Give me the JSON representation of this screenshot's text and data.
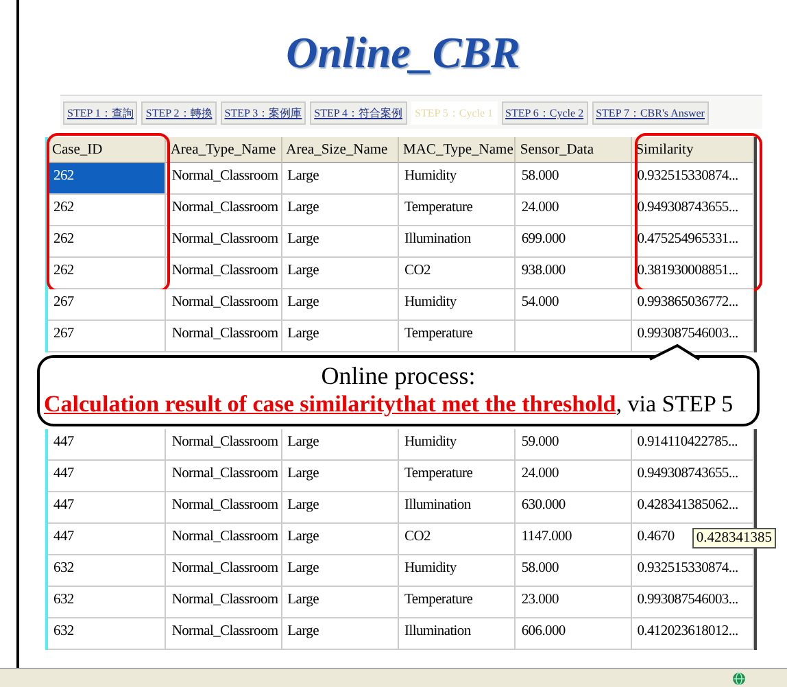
{
  "title": "Online_CBR",
  "tabs": [
    {
      "label": "STEP 1：查詢",
      "selected": false
    },
    {
      "label": "STEP 2：轉換",
      "selected": false
    },
    {
      "label": "STEP 3：案例庫",
      "selected": false
    },
    {
      "label": "STEP 4：符合案例",
      "selected": false
    },
    {
      "label": "STEP 5：Cycle 1",
      "selected": true
    },
    {
      "label": "STEP 6：Cycle 2",
      "selected": false
    },
    {
      "label": "STEP 7：CBR's Answer",
      "selected": false
    }
  ],
  "table": {
    "columns": [
      {
        "label": "Case_ID",
        "highlighted": true
      },
      {
        "label": "Area_Type_Name",
        "highlighted": false
      },
      {
        "label": "Area_Size_Name",
        "highlighted": false
      },
      {
        "label": "MAC_Type_Name",
        "highlighted": false
      },
      {
        "label": "Sensor_Data",
        "highlighted": false
      },
      {
        "label": "Similarity",
        "highlighted": true
      }
    ],
    "rows_before": [
      {
        "cells": [
          "262",
          "Normal_Classroom",
          "Large",
          "Humidity",
          "58.000",
          "0.932515330874..."
        ],
        "selected": true,
        "highlighted": true
      },
      {
        "cells": [
          "262",
          "Normal_Classroom",
          "Large",
          "Temperature",
          "24.000",
          "0.949308743655..."
        ],
        "selected": false,
        "highlighted": true
      },
      {
        "cells": [
          "262",
          "Normal_Classroom",
          "Large",
          "Illumination",
          "699.000",
          "0.475254965331..."
        ],
        "selected": false,
        "highlighted": true
      },
      {
        "cells": [
          "262",
          "Normal_Classroom",
          "Large",
          "CO2",
          "938.000",
          "0.381930008851..."
        ],
        "selected": false,
        "highlighted": true
      },
      {
        "cells": [
          "267",
          "Normal_Classroom",
          "Large",
          "Humidity",
          "54.000",
          "0.993865036772..."
        ],
        "selected": false,
        "highlighted": false
      },
      {
        "cells": [
          "267",
          "Normal_Classroom",
          "Large",
          "Temperature",
          "",
          "0.993087546003..."
        ],
        "selected": false,
        "highlighted": false
      }
    ],
    "rows_after": [
      {
        "cells": [
          "447",
          "Normal_Classroom",
          "Large",
          "Humidity",
          "59.000",
          "0.914110422785..."
        ],
        "selected": false
      },
      {
        "cells": [
          "447",
          "Normal_Classroom",
          "Large",
          "Temperature",
          "24.000",
          "0.949308743655..."
        ],
        "selected": false
      },
      {
        "cells": [
          "447",
          "Normal_Classroom",
          "Large",
          "Illumination",
          "630.000",
          "0.428341385062..."
        ],
        "selected": false
      },
      {
        "cells": [
          "447",
          "Normal_Classroom",
          "Large",
          "CO2",
          "1147.000",
          "0.4670"
        ],
        "selected": false,
        "tooltip": "0.428341385"
      },
      {
        "cells": [
          "632",
          "Normal_Classroom",
          "Large",
          "Humidity",
          "58.000",
          "0.932515330874..."
        ],
        "selected": false
      },
      {
        "cells": [
          "632",
          "Normal_Classroom",
          "Large",
          "Temperature",
          "23.000",
          "0.993087546003..."
        ],
        "selected": false
      },
      {
        "cells": [
          "632",
          "Normal_Classroom",
          "Large",
          "Illumination",
          "606.000",
          "0.412023618012..."
        ],
        "selected": false
      }
    ]
  },
  "callout": {
    "heading": "Online process:",
    "text": "**Calculation result of case similaritythat met the threshold**, via STEP 5"
  }
}
